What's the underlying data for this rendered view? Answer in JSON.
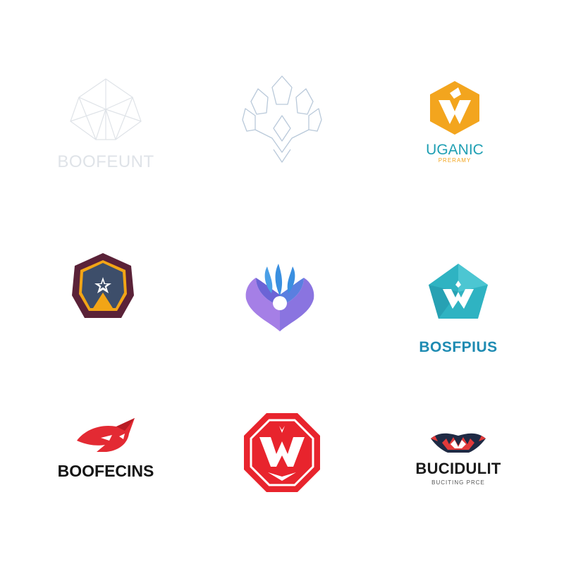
{
  "logos": [
    {
      "name": "logo-1",
      "wordmark": "BOOFEUNT",
      "tagline": "",
      "colors": {
        "line": "#dfe3e8",
        "text": "#dfe3e8"
      }
    },
    {
      "name": "logo-2",
      "wordmark": "",
      "tagline": "",
      "colors": {
        "line": "#b9c9da"
      }
    },
    {
      "name": "logo-3",
      "wordmark": "UGANIC",
      "tagline": "PRERAMY",
      "colors": {
        "primary": "#f3a51e",
        "text": "#1f9fb3",
        "tagline": "#f3a51e"
      }
    },
    {
      "name": "logo-4",
      "wordmark": "",
      "tagline": "",
      "colors": {
        "outer": "#5a2238",
        "inner": "#3d4e6a",
        "accent": "#f2a516"
      }
    },
    {
      "name": "logo-5",
      "wordmark": "",
      "tagline": "",
      "colors": {
        "blue": "#3a8fe0",
        "purple": "#a57fe6",
        "violet": "#6b64d6"
      }
    },
    {
      "name": "logo-6",
      "wordmark": "BOSFPIUS",
      "tagline": "",
      "colors": {
        "primary": "#2fb3c2",
        "text": "#1e8bb2"
      }
    },
    {
      "name": "logo-7",
      "wordmark": "BOOFECINS",
      "tagline": "",
      "colors": {
        "primary": "#e32a33",
        "text": "#141414"
      }
    },
    {
      "name": "logo-8",
      "wordmark": "",
      "tagline": "",
      "colors": {
        "primary": "#e8242d"
      }
    },
    {
      "name": "logo-9",
      "wordmark": "BUCIDULIT",
      "tagline": "BUCITING PRCE",
      "colors": {
        "dark": "#1f2a44",
        "red": "#e23a3a",
        "text": "#1b1b1b"
      }
    }
  ]
}
